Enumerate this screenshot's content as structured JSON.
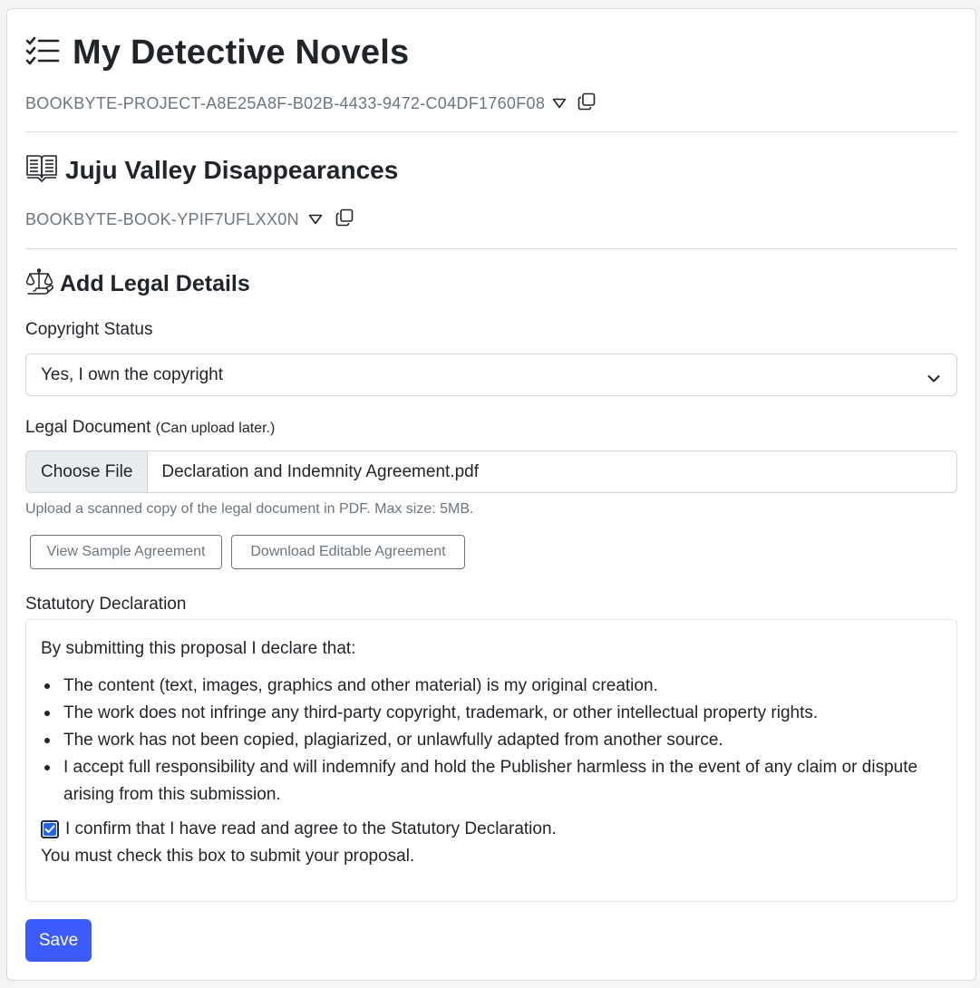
{
  "project": {
    "title": "My Detective Novels",
    "id": "BOOKBYTE-PROJECT-A8E25A8F-B02B-4433-9472-C04DF1760F08"
  },
  "book": {
    "title": "Juju Valley Disappearances",
    "id": "BOOKBYTE-BOOK-YPIF7UFLXX0N"
  },
  "section": {
    "title": "Add Legal Details"
  },
  "form": {
    "copyright_label": "Copyright Status",
    "copyright_value": "Yes, I own the copyright",
    "legal_doc_label": "Legal Document",
    "legal_doc_note": "(Can upload later.)",
    "choose_file_label": "Choose File",
    "file_name": "Declaration and Indemnity Agreement.pdf",
    "help_text": "Upload a scanned copy of the legal document in PDF. Max size: 5MB.",
    "view_sample_label": "View Sample Agreement",
    "download_editable_label": "Download Editable Agreement",
    "declaration_label": "Statutory Declaration",
    "declaration_intro": "By submitting this proposal I declare that:",
    "declaration_items": [
      "The content (text, images, graphics and other material) is my original creation.",
      "The work does not infringe any third-party copyright, trademark, or other intellectual property rights.",
      "The work has not been copied, plagiarized, or unlawfully adapted from another source.",
      "I accept full responsibility and will indemnify and hold the Publisher harmless in the event of any claim or dispute arising from this submission."
    ],
    "confirm_label": "I confirm that I have read and agree to the Statutory Declaration.",
    "confirm_checked": true,
    "must_check_text": "You must check this box to submit your proposal.",
    "save_label": "Save"
  },
  "icons": {
    "project": "checklist-icon",
    "book": "open-book-icon",
    "section": "scales-of-justice-icon",
    "dropdown": "caret-down-icon",
    "copy": "copy-icon",
    "select_chevron": "chevron-down-icon"
  },
  "colors": {
    "primary": "#3b5bfb",
    "checkbox_fill": "#2563eb",
    "muted_text": "#6c757d"
  }
}
